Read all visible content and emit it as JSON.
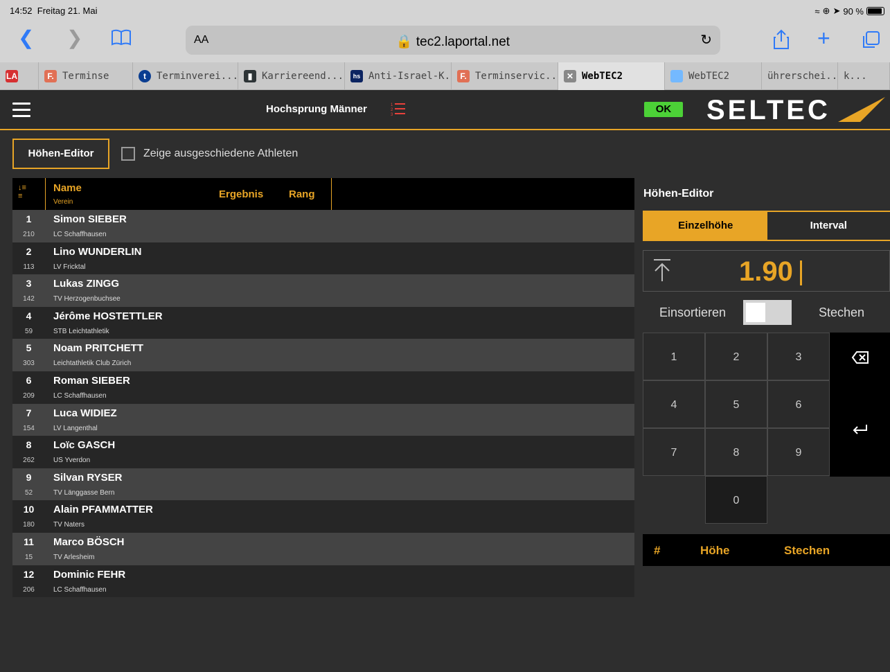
{
  "status": {
    "time": "14:52",
    "date": "Freitag 21. Mai",
    "battery": "90 %"
  },
  "browser": {
    "aa": "AA",
    "url": "tec2.laportal.net",
    "tabs": [
      {
        "label": "",
        "favicon": "LA"
      },
      {
        "label": "Terminse",
        "favicon": "F."
      },
      {
        "label": "Terminverei...",
        "favicon": "t"
      },
      {
        "label": "Karriereend...",
        "favicon": "bar-chart"
      },
      {
        "label": "Anti-Israel-K...",
        "favicon": "hs"
      },
      {
        "label": "Terminservic...",
        "favicon": "F."
      },
      {
        "label": "WebTEC2",
        "favicon": "close"
      },
      {
        "label": "WebTEC2",
        "favicon": "doc"
      },
      {
        "label": "ührerschei...",
        "favicon": ""
      },
      {
        "label": "k...",
        "favicon": ""
      }
    ]
  },
  "app": {
    "event": "Hochsprung Männer",
    "ok": "OK",
    "logo": "SELTEC",
    "editor_button": "Höhen-Editor",
    "show_eliminated": "Zeige ausgeschiedene Athleten",
    "accent": "#e8a526"
  },
  "table": {
    "headers": {
      "name": "Name",
      "verein": "Verein",
      "ergebnis": "Ergebnis",
      "rang": "Rang"
    },
    "rows": [
      {
        "num": "1",
        "bib": "210",
        "name": "Simon SIEBER",
        "club": "LC Schaffhausen"
      },
      {
        "num": "2",
        "bib": "113",
        "name": "Lino WUNDERLIN",
        "club": "LV Fricktal"
      },
      {
        "num": "3",
        "bib": "142",
        "name": "Lukas ZINGG",
        "club": "TV Herzogenbuchsee"
      },
      {
        "num": "4",
        "bib": "59",
        "name": "Jérôme HOSTETTLER",
        "club": "STB Leichtathletik"
      },
      {
        "num": "5",
        "bib": "303",
        "name": "Noam PRITCHETT",
        "club": "Leichtathletik Club Zürich"
      },
      {
        "num": "6",
        "bib": "209",
        "name": "Roman SIEBER",
        "club": "LC Schaffhausen"
      },
      {
        "num": "7",
        "bib": "154",
        "name": "Luca WIDIEZ",
        "club": "LV Langenthal"
      },
      {
        "num": "8",
        "bib": "262",
        "name": "Loïc GASCH",
        "club": "US Yverdon"
      },
      {
        "num": "9",
        "bib": "52",
        "name": "Silvan RYSER",
        "club": "TV Länggasse Bern"
      },
      {
        "num": "10",
        "bib": "180",
        "name": "Alain PFAMMATTER",
        "club": "TV Naters"
      },
      {
        "num": "11",
        "bib": "15",
        "name": "Marco BÖSCH",
        "club": "TV Arlesheim"
      },
      {
        "num": "12",
        "bib": "206",
        "name": "Dominic FEHR",
        "club": "LC Schaffhausen"
      }
    ]
  },
  "editor": {
    "title": "Höhen-Editor",
    "tab_single": "Einzelhöhe",
    "tab_interval": "Interval",
    "height": "1.90",
    "einsortieren": "Einsortieren",
    "stechen": "Stechen",
    "keys": [
      "1",
      "2",
      "3",
      "4",
      "5",
      "6",
      "7",
      "8",
      "9",
      "0"
    ],
    "hist_hash": "#",
    "hist_hoehe": "Höhe",
    "hist_stechen": "Stechen"
  }
}
